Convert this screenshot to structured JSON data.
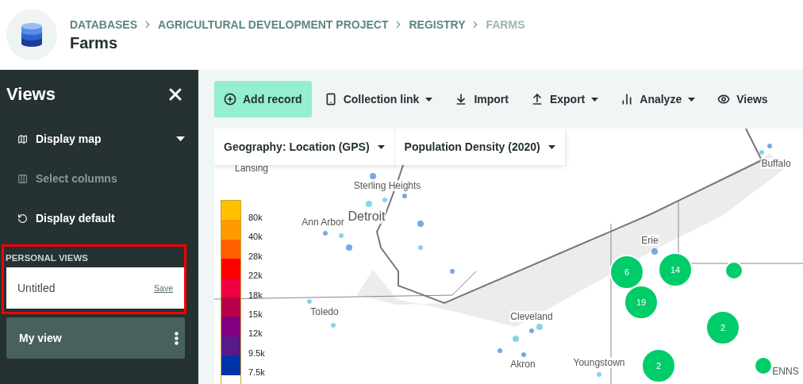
{
  "header": {
    "breadcrumbs": [
      {
        "label": "DATABASES",
        "current": false
      },
      {
        "label": "AGRICULTURAL DEVELOPMENT PROJECT",
        "current": false
      },
      {
        "label": "REGISTRY",
        "current": false
      },
      {
        "label": "FARMS",
        "current": true
      }
    ],
    "title": "Farms"
  },
  "sidebar": {
    "title": "Views",
    "items": [
      {
        "label": "Display map",
        "dropdown": true,
        "disabled": false
      },
      {
        "label": "Select columns",
        "dropdown": false,
        "disabled": true
      },
      {
        "label": "Display default",
        "dropdown": false,
        "disabled": false
      }
    ],
    "personal_views": {
      "heading": "PERSONAL VIEWS",
      "highlighted": true,
      "draft": {
        "name": "Untitled",
        "action": "Save"
      },
      "saved": [
        {
          "name": "My view"
        }
      ]
    }
  },
  "toolbar": [
    {
      "label": "Add record",
      "dropdown": false,
      "primary": true
    },
    {
      "label": "Collection link",
      "dropdown": true,
      "primary": false
    },
    {
      "label": "Import",
      "dropdown": false,
      "primary": false
    },
    {
      "label": "Export",
      "dropdown": true,
      "primary": false
    },
    {
      "label": "Analyze",
      "dropdown": true,
      "primary": false
    },
    {
      "label": "Views",
      "dropdown": false,
      "primary": false
    }
  ],
  "map": {
    "filters": [
      {
        "label": "Geography: Location (GPS)"
      },
      {
        "label": "Population Density (2020)"
      }
    ],
    "legend": [
      {
        "label": "80k",
        "color": "#ffc000"
      },
      {
        "label": "40k",
        "color": "#ff9a00"
      },
      {
        "label": "28k",
        "color": "#ff6000"
      },
      {
        "label": "22k",
        "color": "#ff0000"
      },
      {
        "label": "18k",
        "color": "#ee0040"
      },
      {
        "label": "15k",
        "color": "#b8004a"
      },
      {
        "label": "12k",
        "color": "#800080"
      },
      {
        "label": "9.5k",
        "color": "#5a1a8a"
      },
      {
        "label": "7.5k",
        "color": "#0033aa"
      }
    ],
    "places": [
      {
        "name": "Lansing"
      },
      {
        "name": "Buffalo"
      },
      {
        "name": "Sterling Heights"
      },
      {
        "name": "Ann Arbor"
      },
      {
        "name": "Detroit"
      },
      {
        "name": "Erie"
      },
      {
        "name": "Toledo"
      },
      {
        "name": "Cleveland"
      },
      {
        "name": "Akron"
      },
      {
        "name": "Youngstown"
      },
      {
        "name": "ENNS"
      }
    ],
    "clusters": [
      {
        "kind": "cluster",
        "count": "6"
      },
      {
        "kind": "cluster",
        "count": "14"
      },
      {
        "kind": "point"
      },
      {
        "kind": "cluster",
        "count": "19"
      },
      {
        "kind": "cluster",
        "count": "2"
      },
      {
        "kind": "cluster",
        "count": "2"
      },
      {
        "kind": "point"
      }
    ]
  }
}
